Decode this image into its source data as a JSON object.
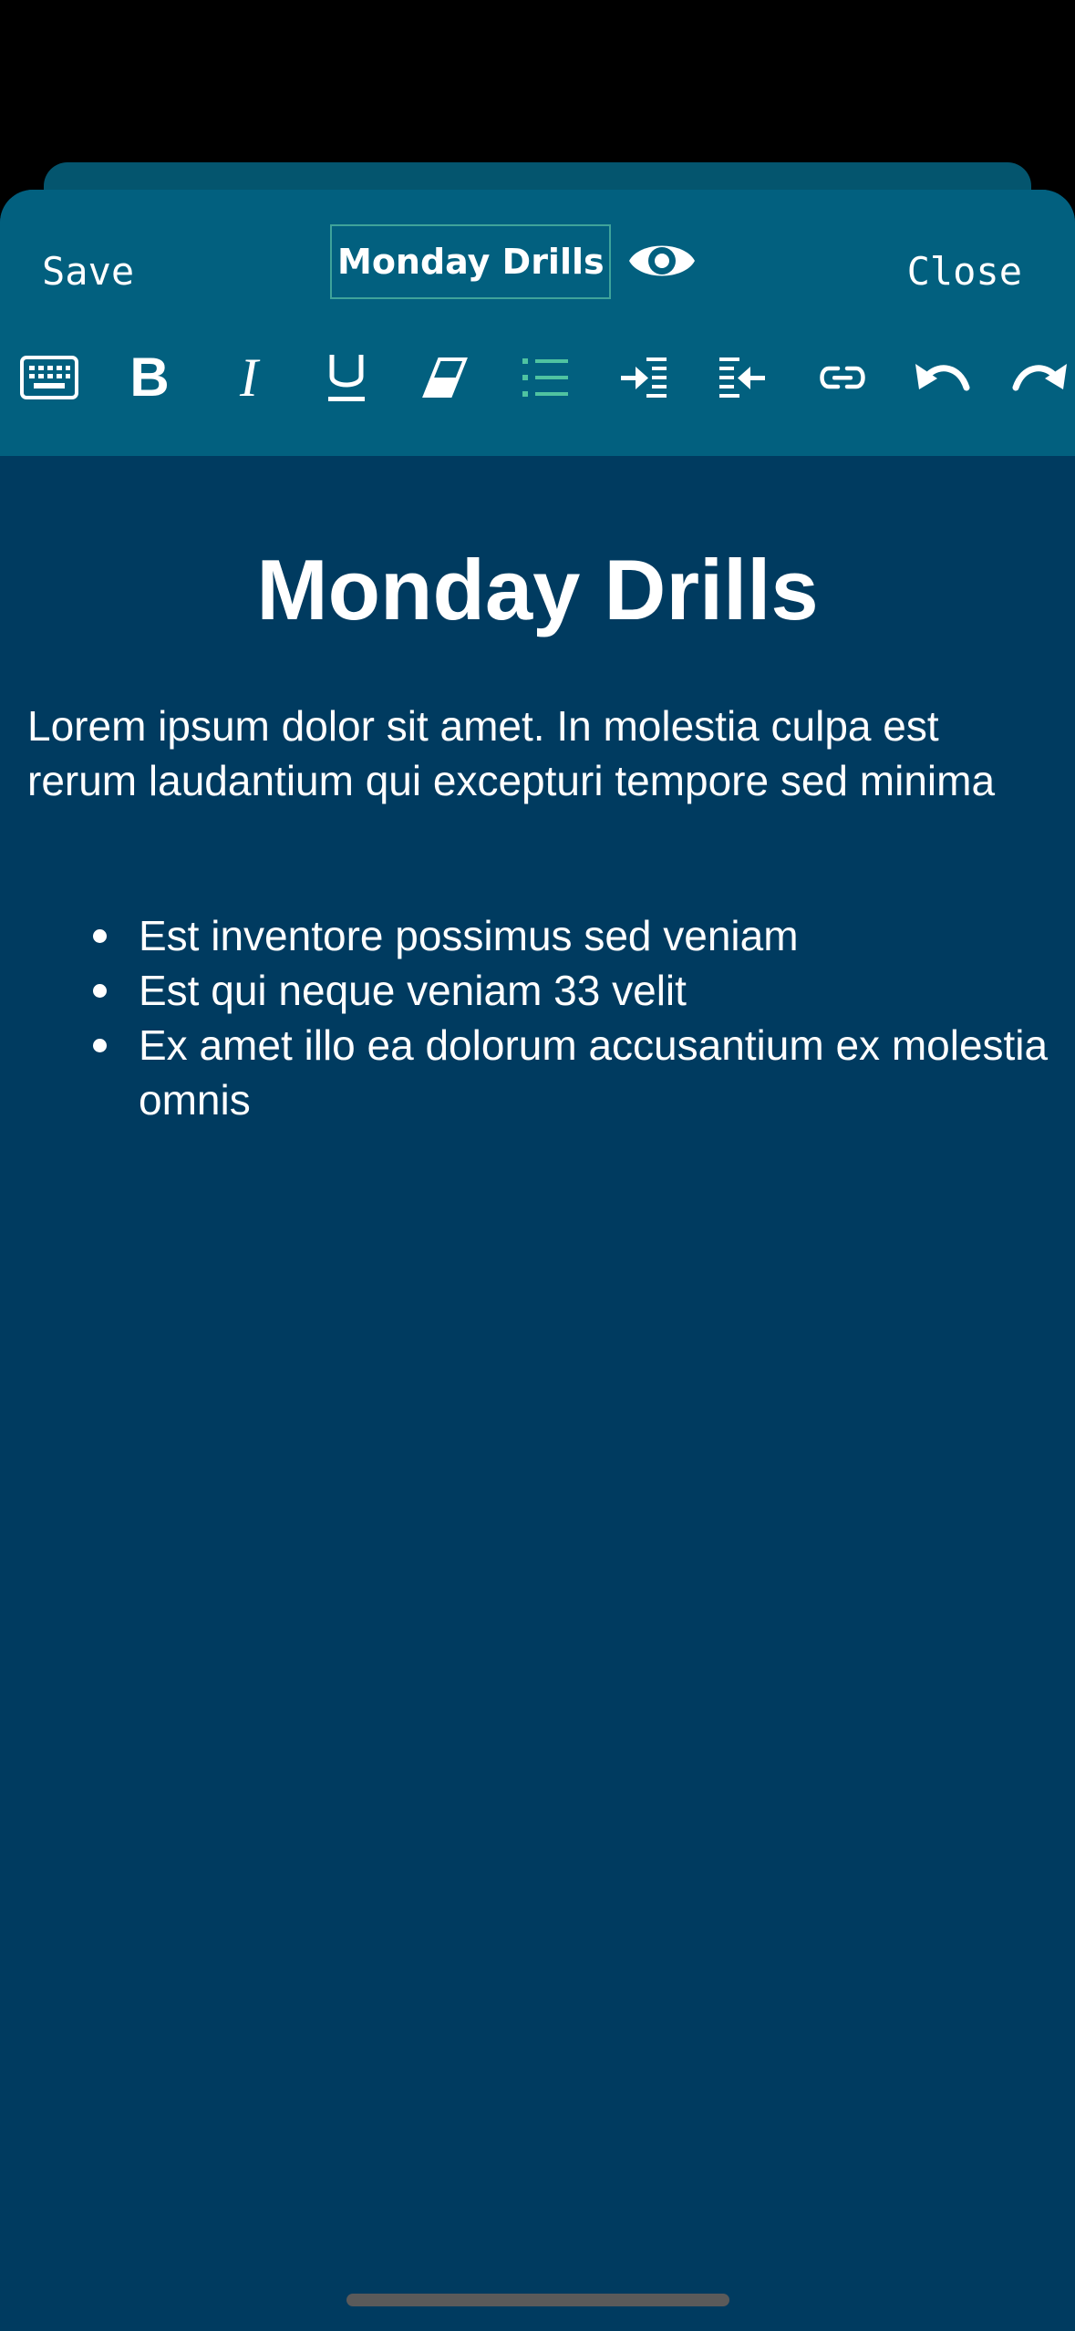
{
  "header": {
    "save_label": "Save",
    "title_value": "Monday Drills",
    "close_label": "Close"
  },
  "toolbar": [
    {
      "name": "keyboard-icon"
    },
    {
      "name": "bold-icon",
      "glyph": "B"
    },
    {
      "name": "italic-icon",
      "glyph": "I"
    },
    {
      "name": "underline-icon",
      "glyph": "U"
    },
    {
      "name": "eraser-icon"
    },
    {
      "name": "bullet-list-icon"
    },
    {
      "name": "indent-icon"
    },
    {
      "name": "outdent-icon"
    },
    {
      "name": "link-icon"
    },
    {
      "name": "undo-icon"
    },
    {
      "name": "redo-icon"
    }
  ],
  "document": {
    "title": "Monday Drills",
    "paragraph": "Lorem ipsum dolor sit amet. In molestia culpa est rerum laudantium qui excepturi tempore sed minima",
    "bullets": [
      "Est inventore possimus sed veniam",
      "Est qui neque veniam 33 velit",
      "Ex amet illo ea dolorum accusantium ex molestia omnis"
    ]
  },
  "colors": {
    "background": "#003b60",
    "header": "#02607f",
    "accent": "#3fa39a",
    "text": "#ffffff"
  }
}
